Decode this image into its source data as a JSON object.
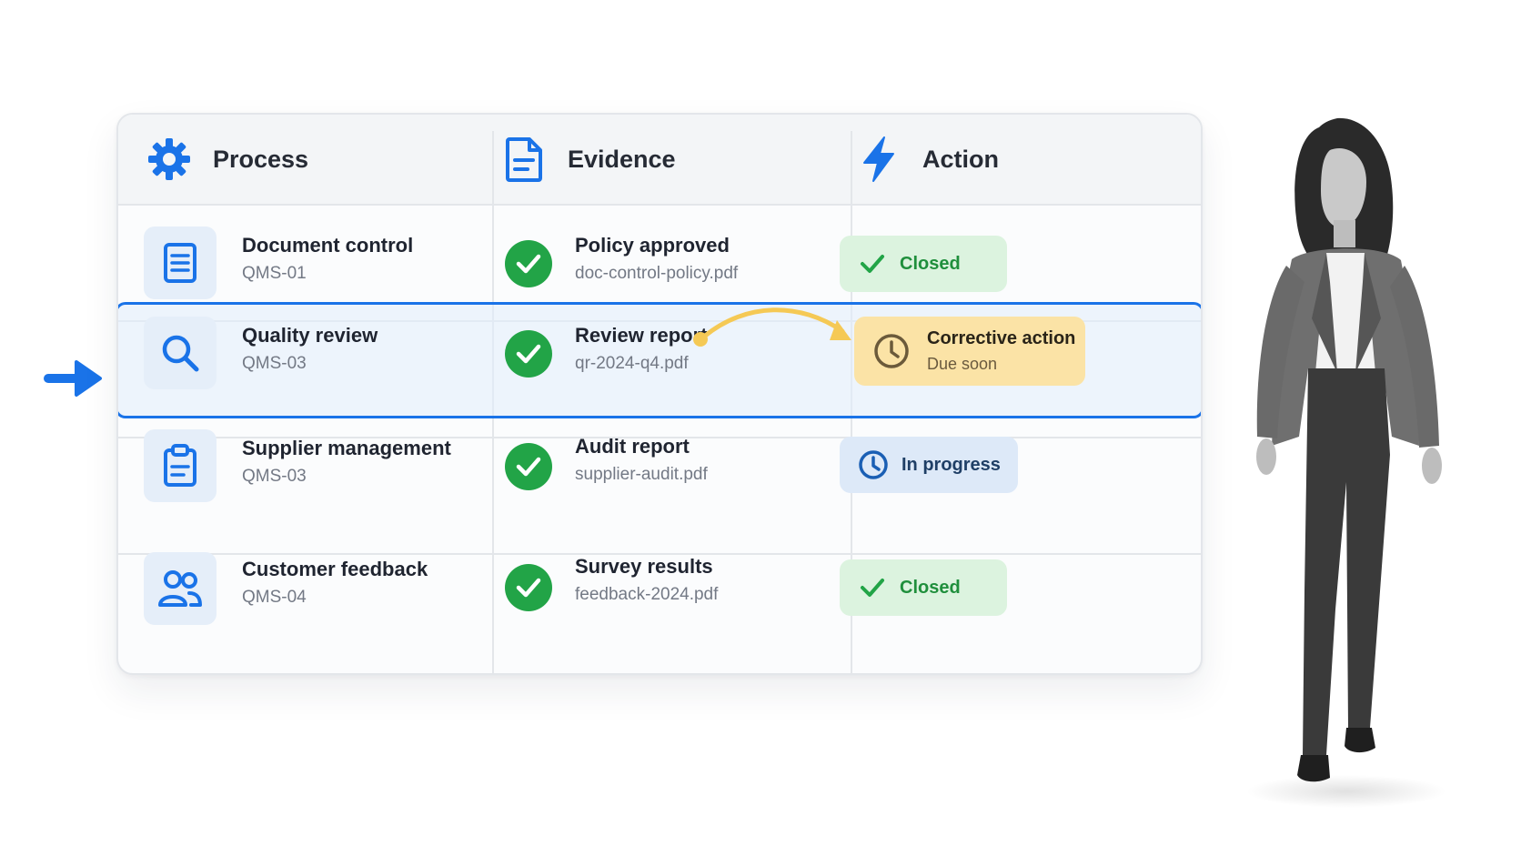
{
  "header": {
    "process_label": "Process",
    "evidence_label": "Evidence",
    "action_label": "Action",
    "icons": [
      "gear-icon",
      "document-icon",
      "lightning-icon"
    ]
  },
  "rows": [
    {
      "process": {
        "title": "Document control",
        "code": "QMS-01",
        "icon": "document-lines-icon"
      },
      "evidence": {
        "title": "Policy approved",
        "file": "doc-control-policy.pdf",
        "icon": "check-circle-icon"
      },
      "action": {
        "status": "Closed",
        "icon": "check-icon"
      }
    },
    {
      "process": {
        "title": "Quality review",
        "code": "QMS-03",
        "icon": "search-icon"
      },
      "evidence": {
        "title": "Review report",
        "file": "qr-2024-q4.pdf",
        "icon": "check-circle-icon"
      },
      "action": {
        "status": "Corrective action",
        "sub": "Due soon",
        "icon": "clock-icon"
      },
      "highlighted": true
    },
    {
      "process": {
        "title": "Supplier management",
        "code": "QMS-03",
        "icon": "clipboard-icon"
      },
      "evidence": {
        "title": "Audit report",
        "file": "supplier-audit.pdf",
        "icon": "check-circle-icon"
      },
      "action": {
        "status": "In progress",
        "icon": "clock-icon"
      }
    },
    {
      "process": {
        "title": "Customer feedback",
        "code": "QMS-04",
        "icon": "users-icon"
      },
      "evidence": {
        "title": "Survey results",
        "file": "feedback-2024.pdf",
        "icon": "check-circle-icon"
      },
      "action": {
        "status": "Closed",
        "icon": "check-icon"
      }
    }
  ],
  "colors": {
    "accent_blue": "#1a73e8",
    "success_green": "#22a447",
    "closed_badge_bg": "#dcf3df",
    "progress_badge_bg": "#dde9f8",
    "warning_badge_bg": "#fbe3a6",
    "connector_yellow": "#f5c955"
  },
  "decorations": [
    "pointer-arrow-icon",
    "curved-connector-arrow",
    "person-photo"
  ]
}
